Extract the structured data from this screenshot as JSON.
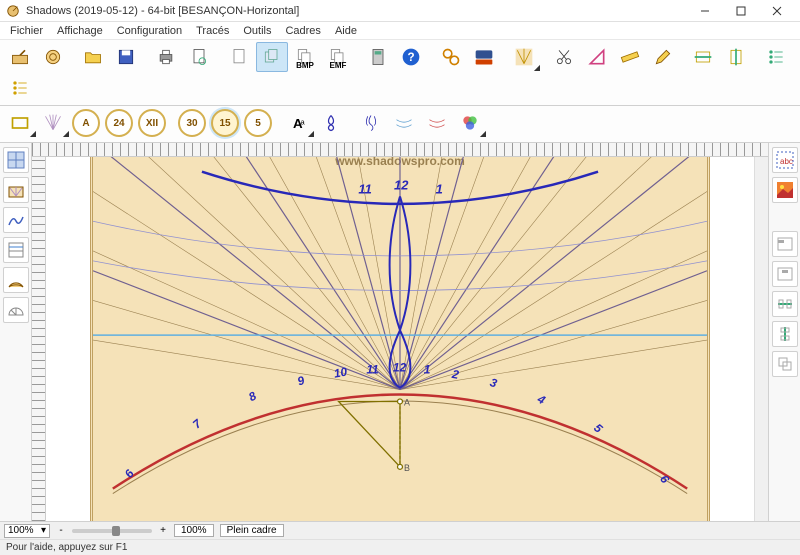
{
  "window": {
    "title": "Shadows (2019-05-12) - 64-bit [BESANÇON-Horizontal]"
  },
  "menu": [
    "Fichier",
    "Affichage",
    "Configuration",
    "Tracés",
    "Outils",
    "Cadres",
    "Aide"
  ],
  "toolbar1": {
    "bmp": "BMP",
    "emf": "EMF"
  },
  "toolbar2": {
    "btns": [
      "A",
      "24",
      "XII",
      "30",
      "15",
      "5"
    ]
  },
  "canvas": {
    "watermark": "www.shadowspro.com",
    "hours_top": {
      "11": "11",
      "12": "12",
      "1": "1"
    },
    "hours_bottom": [
      "6",
      "7",
      "8",
      "9",
      "10",
      "11",
      "12",
      "1",
      "2",
      "3",
      "4",
      "5",
      "6"
    ],
    "gnomon": {
      "A": "A",
      "B": "B"
    }
  },
  "status": {
    "zoom": "100%",
    "btn_plus": "+",
    "btn_reset": "100%",
    "btn_frame": "Plein cadre"
  },
  "help": "Pour l'aide, appuyez sur F1"
}
